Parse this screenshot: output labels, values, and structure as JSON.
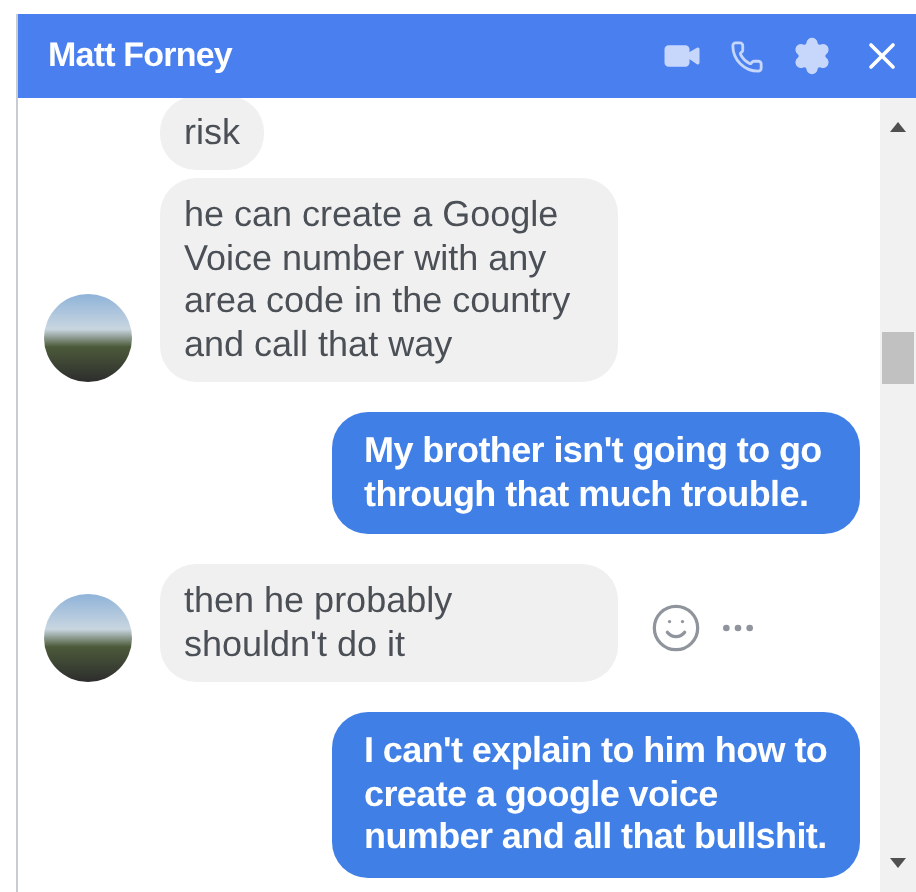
{
  "window": {
    "title": "Matt Forney"
  },
  "messages": [
    {
      "kind": "received",
      "text": "risk",
      "avatar": false,
      "actions": false
    },
    {
      "kind": "received",
      "text": "he can create a Google Voice number with any area code in the country and call that way",
      "avatar": true,
      "actions": false
    },
    {
      "kind": "sent",
      "text": "My brother isn't going to go through that much trouble.",
      "avatar": false,
      "actions": false
    },
    {
      "kind": "received",
      "text": "then he probably shouldn't do it",
      "avatar": true,
      "actions": true
    },
    {
      "kind": "sent",
      "text": "I can't explain to him how to create a google voice number and all that bullshit.",
      "avatar": false,
      "actions": false
    }
  ]
}
